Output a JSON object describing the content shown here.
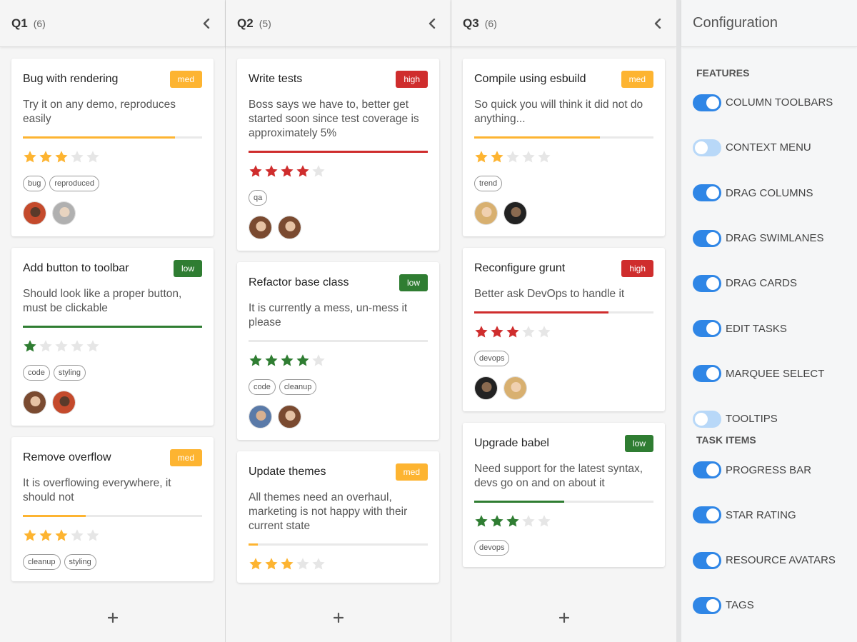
{
  "colors": {
    "med": "#fdb431",
    "high": "#cf2d2d",
    "low": "#2f7d32",
    "toggle_on": "#2f86e6",
    "toggle_off": "#b8d8f8"
  },
  "columns": [
    {
      "title": "Q1",
      "count": "(6)",
      "add_icon": "plus-icon",
      "cards": [
        {
          "title": "Bug with rendering",
          "priority": "med",
          "description": "Try it on any demo, reproduces easily",
          "progress": 0.85,
          "rating": 3,
          "tags": [
            "bug",
            "reproduced"
          ],
          "avatars": [
            "avatar-man-red",
            "avatar-man-gray"
          ]
        },
        {
          "title": "Add button to toolbar",
          "priority": "low",
          "description": "Should look like a proper button, must be clickable",
          "progress": 1.0,
          "rating": 1,
          "tags": [
            "code",
            "styling"
          ],
          "avatars": [
            "avatar-woman",
            "avatar-man-red"
          ]
        },
        {
          "title": "Remove overflow",
          "priority": "med",
          "description": "It is overflowing everywhere, it should not",
          "progress": 0.35,
          "rating": 3,
          "tags": [
            "cleanup",
            "styling"
          ],
          "avatars": []
        }
      ]
    },
    {
      "title": "Q2",
      "count": "(5)",
      "add_icon": "plus-icon",
      "cards": [
        {
          "title": "Write tests",
          "priority": "high",
          "description": "Boss says we have to, better get started soon since test coverage is approximately 5%",
          "progress": 1.0,
          "rating": 4,
          "tags": [
            "qa"
          ],
          "avatars": [
            "avatar-woman",
            "avatar-woman"
          ]
        },
        {
          "title": "Refactor base class",
          "priority": "low",
          "description": "It is currently a mess, un-mess it please",
          "progress": 0.0,
          "rating": 4,
          "tags": [
            "code",
            "cleanup"
          ],
          "avatars": [
            "avatar-man-blue",
            "avatar-woman"
          ]
        },
        {
          "title": "Update themes",
          "priority": "med",
          "description": "All themes need an overhaul, marketing is not happy with their current state",
          "progress": 0.05,
          "rating": 3,
          "tags": [],
          "avatars": []
        }
      ]
    },
    {
      "title": "Q3",
      "count": "(6)",
      "add_icon": "plus-icon",
      "cards": [
        {
          "title": "Compile using esbuild",
          "priority": "med",
          "description": "So quick you will think it did not do anything...",
          "progress": 0.7,
          "rating": 2,
          "tags": [
            "trend"
          ],
          "avatars": [
            "avatar-woman-blonde",
            "avatar-man-dark"
          ]
        },
        {
          "title": "Reconfigure grunt",
          "priority": "high",
          "description": "Better ask DevOps to handle it",
          "progress": 0.75,
          "rating": 3,
          "tags": [
            "devops"
          ],
          "avatars": [
            "avatar-man-dark",
            "avatar-woman-blonde"
          ]
        },
        {
          "title": "Upgrade babel",
          "priority": "low",
          "description": "Need support for the latest syntax, devs go on and on about it",
          "progress": 0.5,
          "rating": 3,
          "tags": [
            "devops"
          ],
          "avatars": []
        }
      ]
    }
  ],
  "config": {
    "title": "Configuration",
    "features_label": "FEATURES",
    "features": [
      {
        "label": "COLUMN TOOLBARS",
        "on": true
      },
      {
        "label": "CONTEXT MENU",
        "on": false
      },
      {
        "label": "DRAG COLUMNS",
        "on": true
      },
      {
        "label": "DRAG SWIMLANES",
        "on": true
      },
      {
        "label": "DRAG CARDS",
        "on": true
      },
      {
        "label": "EDIT TASKS",
        "on": true
      },
      {
        "label": "MARQUEE SELECT",
        "on": true
      },
      {
        "label": "TOOLTIPS",
        "on": false
      }
    ],
    "task_items_label": "TASK ITEMS",
    "task_items": [
      {
        "label": "PROGRESS BAR",
        "on": true
      },
      {
        "label": "STAR RATING",
        "on": true
      },
      {
        "label": "RESOURCE AVATARS",
        "on": true
      },
      {
        "label": "TAGS",
        "on": true
      }
    ]
  }
}
